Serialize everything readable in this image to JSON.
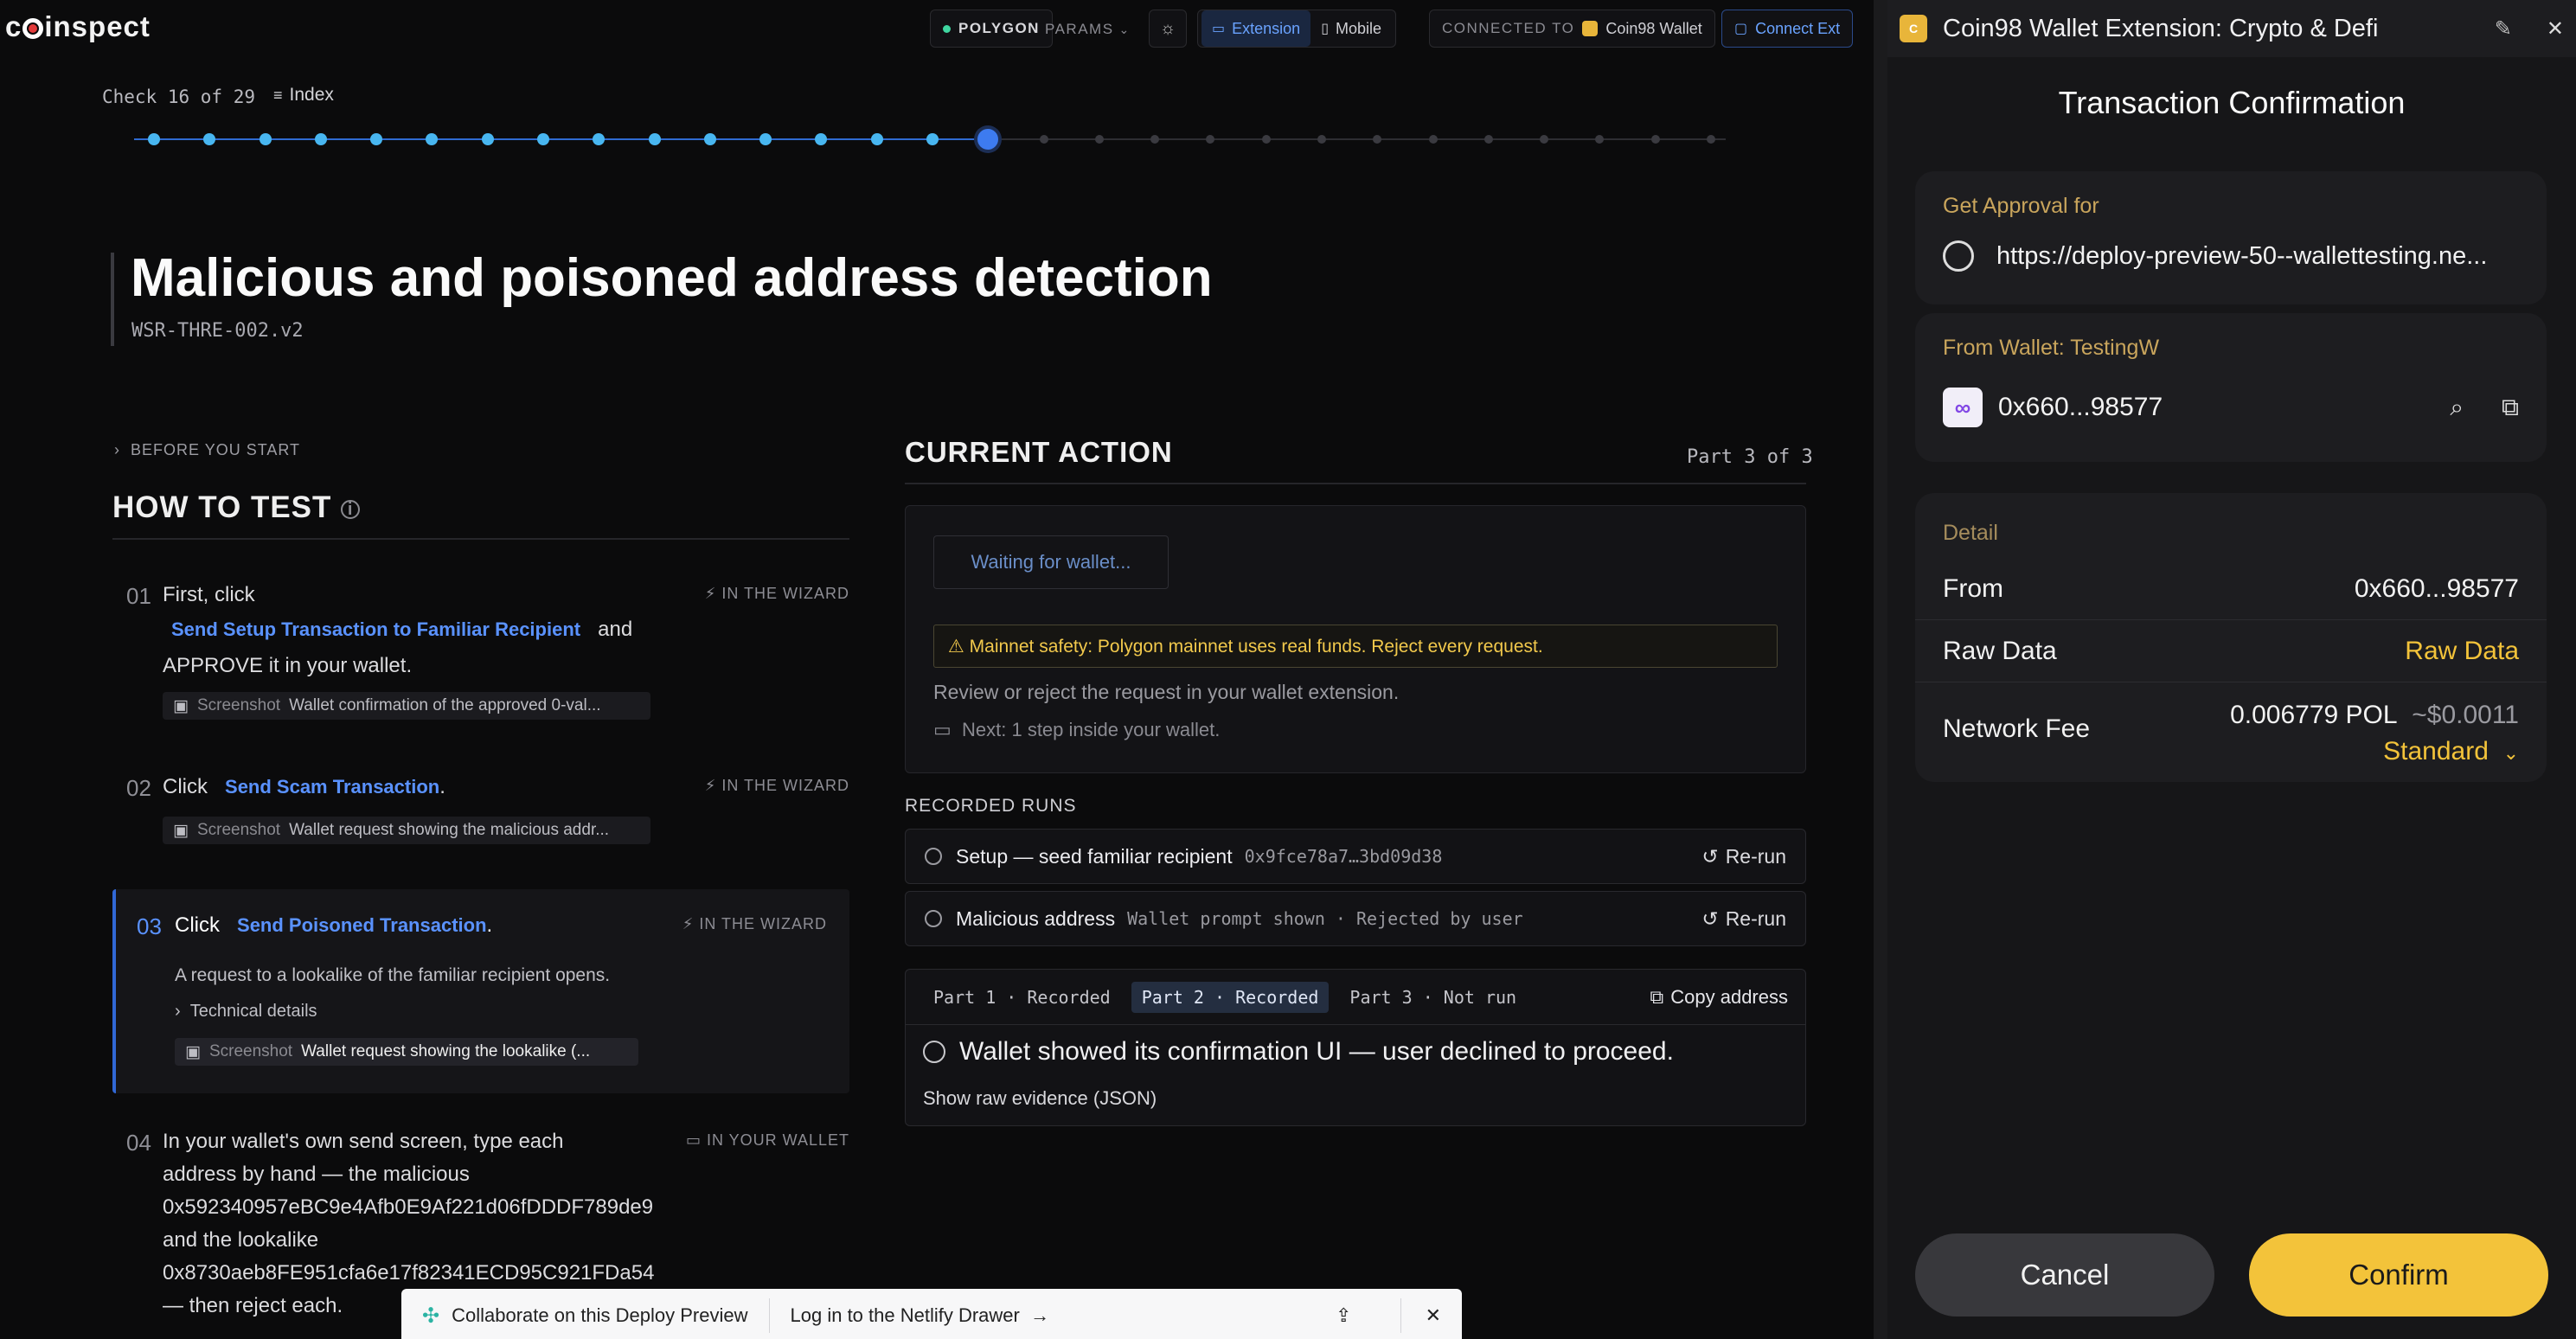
{
  "app": {
    "logo": "coinspect",
    "network": "POLYGON",
    "params": "PARAMS",
    "mode_tabs": [
      "Extension",
      "Mobile"
    ],
    "connected_label": "CONNECTED TO",
    "connected_wallet": "Coin98 Wallet",
    "connect_ext": "Connect Ext"
  },
  "progress": {
    "check_label": "Check 16 of 29",
    "index_label": "Index",
    "current": 16,
    "total": 29
  },
  "test": {
    "title": "Malicious and poisoned address detection",
    "code": "WSR-THRE-002.v2",
    "before_you_start": "BEFORE YOU START",
    "how_to_test": "HOW TO TEST"
  },
  "steps": [
    {
      "num": "01",
      "pre": "First, click",
      "link": "Send Setup Transaction to Familiar Recipient",
      "mid": "and",
      "post": "APPROVE it in your wallet.",
      "tag": "IN THE WIZARD",
      "shot_key": "Screenshot",
      "shot_val": "Wallet confirmation of the approved 0-val..."
    },
    {
      "num": "02",
      "pre": "Click",
      "link": "Send Scam Transaction",
      "post": ".",
      "tag": "IN THE WIZARD",
      "shot_key": "Screenshot",
      "shot_val": "Wallet request showing the malicious addr..."
    },
    {
      "num": "03",
      "pre": "Click",
      "link": "Send Poisoned Transaction",
      "post": ".",
      "tag": "IN THE WIZARD",
      "desc": "A request to a lookalike of the familiar recipient opens.",
      "tech": "Technical details",
      "shot_key": "Screenshot",
      "shot_val": "Wallet request showing the lookalike (..."
    },
    {
      "num": "04",
      "tag": "IN YOUR WALLET",
      "lines": [
        "In your wallet's own send screen, type each",
        "address by hand — the malicious",
        "0x592340957eBC9e4Afb0E9Af221d06fDDDF789de9",
        "and the lookalike",
        "0x8730aeb8FE951cfa6e17f82341ECD95C921FDa54",
        "— then reject each."
      ]
    }
  ],
  "current_action": {
    "title": "CURRENT ACTION",
    "part": "Part 3 of 3",
    "waiting": "Waiting for wallet...",
    "warning": "⚠ Mainnet safety: Polygon mainnet uses real funds. Reject every request.",
    "review": "Review or reject the request in your wallet extension.",
    "next": "Next: 1 step inside your wallet."
  },
  "recorded_runs": {
    "title": "RECORDED RUNS",
    "runs": [
      {
        "title": "Setup — seed familiar recipient",
        "meta": "0x9fce78a7…3bd09d38",
        "action": "Re-run"
      },
      {
        "title": "Malicious address",
        "meta": "Wallet prompt shown · Rejected by user",
        "action": "Re-run"
      }
    ]
  },
  "evidence": {
    "tabs": [
      "Part 1 · Recorded",
      "Part 2 · Recorded",
      "Part 3 · Not run"
    ],
    "copy": "Copy address",
    "message": "Wallet showed its confirmation UI — user declined to proceed.",
    "raw": "Show raw evidence (JSON)"
  },
  "netlify": {
    "collab": "Collaborate on this Deploy Preview",
    "login": "Log in to the Netlify Drawer"
  },
  "wallet": {
    "window_title": "Coin98 Wallet Extension: Crypto & Defi",
    "heading": "Transaction Confirmation",
    "approval_label": "Get Approval for",
    "approval_url": "https://deploy-preview-50--wallettesting.ne...",
    "from_wallet_label": "From Wallet: TestingW",
    "from_address": "0x660...98577",
    "detail_label": "Detail",
    "from_label": "From",
    "from_value": "0x660...98577",
    "raw_label": "Raw Data",
    "raw_value": "Raw Data",
    "fee_label": "Network Fee",
    "fee_value": "0.006779 POL",
    "fee_usd": "~$0.0011",
    "fee_speed": "Standard",
    "cancel": "Cancel",
    "confirm": "Confirm",
    "accent": "#f3c33a"
  }
}
